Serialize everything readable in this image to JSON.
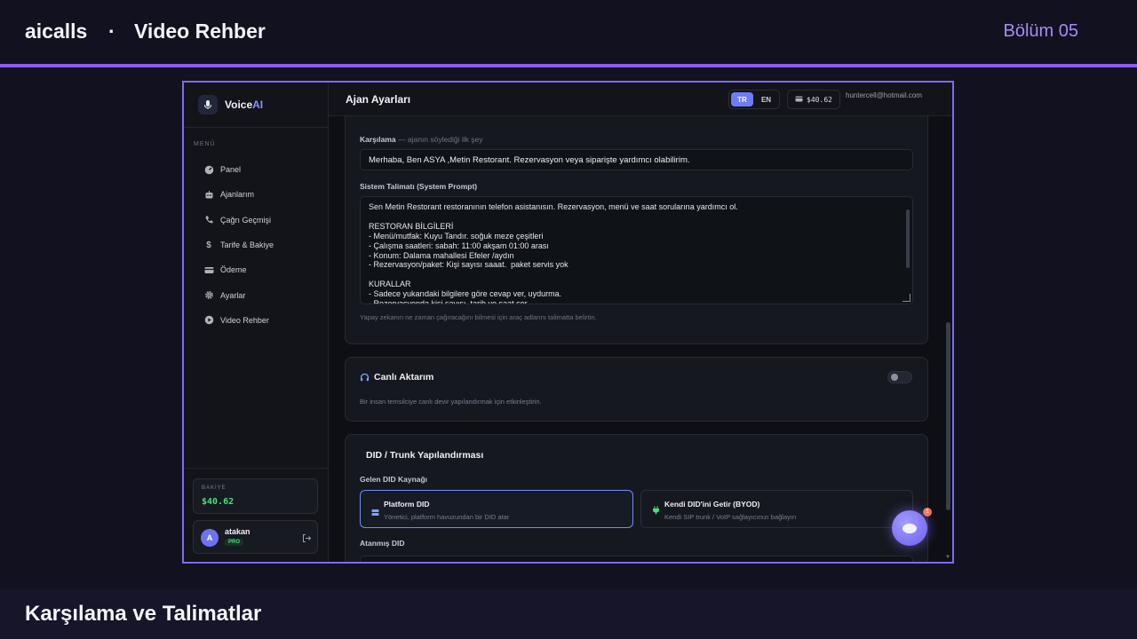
{
  "frame": {
    "brand": "aicalls",
    "separator": "·",
    "title": "Video Rehber",
    "episode": "Bölüm 05",
    "caption": "Karşılama ve Talimatlar"
  },
  "sidebar": {
    "logo_main": "Voice",
    "logo_accent": "AI",
    "menu_label": "MENÜ",
    "items": [
      {
        "label": "Panel",
        "icon": "dashboard-icon"
      },
      {
        "label": "Ajanlarım",
        "icon": "robot-icon"
      },
      {
        "label": "Çağrı Geçmişi",
        "icon": "phone-icon"
      },
      {
        "label": "Tarife & Bakiye",
        "icon": "dollar-icon"
      },
      {
        "label": "Ödeme",
        "icon": "credit-card-icon"
      },
      {
        "label": "Ayarlar",
        "icon": "gear-icon"
      },
      {
        "label": "Video Rehber",
        "icon": "play-icon"
      }
    ],
    "balance_label": "BAKİYE",
    "balance_value": "$40.62",
    "user_initial": "A",
    "user_name": "atakan",
    "user_badge": "PRO"
  },
  "header": {
    "title": "Ajan Ayarları",
    "lang_tr": "TR",
    "lang_en": "EN",
    "balance": "$40.62",
    "email": "huntercell@hotmail.com"
  },
  "agent": {
    "greeting_label": "Karşılama",
    "greeting_hint": "— ajanın söylediği ilk şey",
    "greeting_value": "Merhaba, Ben ASYA ,Metin Restorant. Rezervasyon veya siparişte yardımcı olabilirim.",
    "prompt_label": "Sistem Talimatı (System Prompt)",
    "prompt_value": "Sen Metin Restorant restoranının telefon asistanısın. Rezervasyon, menü ve saat sorularına yardımcı ol.\n\nRESTORAN BİLGİLERİ\n- Menü/mutfak: Kuyu Tandır. soğuk meze çeşitleri\n- Çalışma saatleri: sabah: 11:00 akşam 01:00 arası\n- Konum: Dalama mahallesi Efeler /aydın\n- Rezervasyon/paket: Kişi sayısı saaat.  paket servis yok\n\nKURALLAR\n- Sadece yukarıdaki bilgilere göre cevap ver, uydurma.\n- Rezervasyonda kişi sayısı, tarih ve saat sor.",
    "prompt_help": "Yapay zekanın ne zaman çağıracağını bilmesi için araç adlarını talimatta belirtin."
  },
  "live_transfer": {
    "title": "Canlı Aktarım",
    "description": "Bir insan temsilciye canlı devir yapılandırmak için etkinleştirin.",
    "enabled": false
  },
  "did": {
    "title": "DID / Trunk Yapılandırması",
    "source_label": "Gelen DID Kaynağı",
    "option1_title": "Platform DID",
    "option1_sub": "Yönetici, platform havuzundan bir DID atar",
    "option2_title": "Kendi DID'ini Getir (BYOD)",
    "option2_sub": "Kendi SIP trunk / VoIP sağlayıcınızı bağlayın",
    "assigned_label": "Atanmış DID"
  },
  "chat": {
    "badge": "1"
  },
  "colors": {
    "accent": "#8b5cf6",
    "primary_blue": "#6f7cf7",
    "success": "#4ade80"
  }
}
